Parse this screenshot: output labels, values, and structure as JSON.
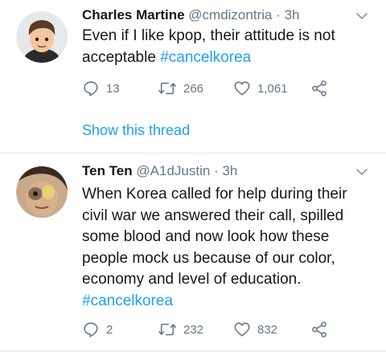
{
  "tweets": [
    {
      "name": "Charles Martine",
      "handle": "@cmdizontria",
      "separator": "·",
      "time": "3h",
      "text_lines": [
        "Even if I like kpop, their attitude is not",
        "acceptable "
      ],
      "hashtag": "#cancelkorea",
      "replies": "13",
      "retweets": "266",
      "likes": "1,061",
      "avatar_icon": "memoji-avatar",
      "show_thread": "Show this thread"
    },
    {
      "name": "Ten Ten",
      "handle": "@A1dJustin",
      "separator": "·",
      "time": "3h",
      "text_lines": [
        "When Korea called for help during their",
        "civil war we answered their call, spilled",
        "some blood and now look how these",
        "people mock us because of our color,",
        "economy and level of education."
      ],
      "hashtag": "#cancelkorea",
      "replies": "2",
      "retweets": "232",
      "likes": "832",
      "avatar_icon": "photo-avatar"
    }
  ],
  "colors": {
    "link": "#1da1f2",
    "muted": "#657786",
    "text": "#14171a",
    "divider": "#e1e8ed"
  }
}
